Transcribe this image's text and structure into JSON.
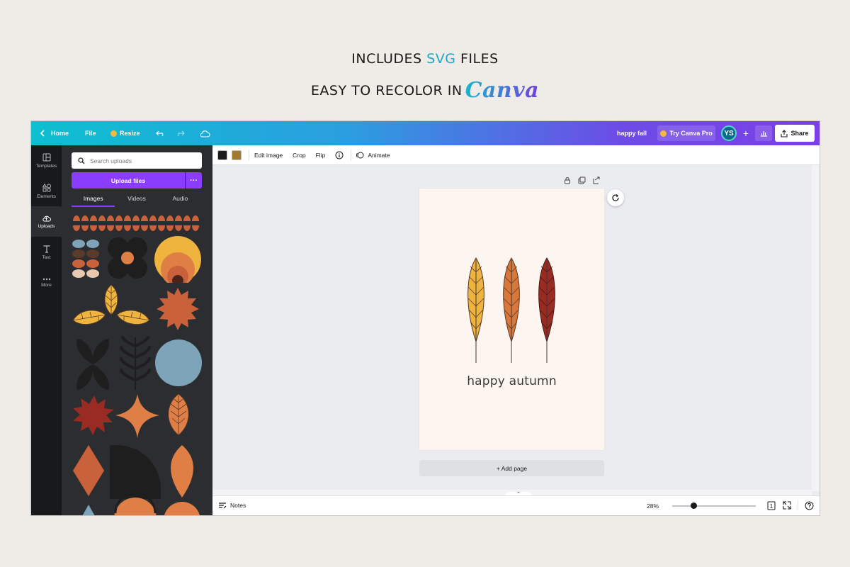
{
  "promo": {
    "line1_pre": "INCLUDES ",
    "line1_hl": "SVG",
    "line1_post": " FILES",
    "line2": "EASY TO RECOLOR IN",
    "brand": "Canva"
  },
  "topbar": {
    "home": "Home",
    "file": "File",
    "resize": "Resize",
    "doc_title": "happy fall",
    "try_pro": "Try Canva Pro",
    "avatar": "YS",
    "share": "Share"
  },
  "rail": [
    {
      "label": "Templates",
      "icon": "templates-icon"
    },
    {
      "label": "Elements",
      "icon": "elements-icon"
    },
    {
      "label": "Uploads",
      "icon": "uploads-icon",
      "active": true
    },
    {
      "label": "Text",
      "icon": "text-icon"
    },
    {
      "label": "More",
      "icon": "more-icon"
    }
  ],
  "panel": {
    "search_placeholder": "Search uploads",
    "upload_btn": "Upload files",
    "tabs": [
      "Images",
      "Videos",
      "Audio"
    ],
    "active_tab": "Images"
  },
  "toolbar": {
    "swatches": [
      "#1c1c1c",
      "#a27a2e"
    ],
    "edit_image": "Edit image",
    "crop": "Crop",
    "flip": "Flip",
    "animate": "Animate"
  },
  "canvas": {
    "text": "happy autumn",
    "bg": "#fcf5f0",
    "leaves": [
      "#efb43e",
      "#d9773a",
      "#9a2b22"
    ]
  },
  "editor": {
    "add_page": "+ Add page",
    "notes": "Notes",
    "zoom": "28%",
    "page_count": "1"
  },
  "colors": {
    "accent": "#8b3dff",
    "panel_bg": "#2c2d30",
    "rail_bg": "#18191b",
    "burnt_orange": "#c9613a",
    "orange": "#e07f45",
    "mustard": "#efb43e",
    "rust": "#9a2b22",
    "slate_blue": "#7ea4ba",
    "dark": "#1e1e1e"
  }
}
